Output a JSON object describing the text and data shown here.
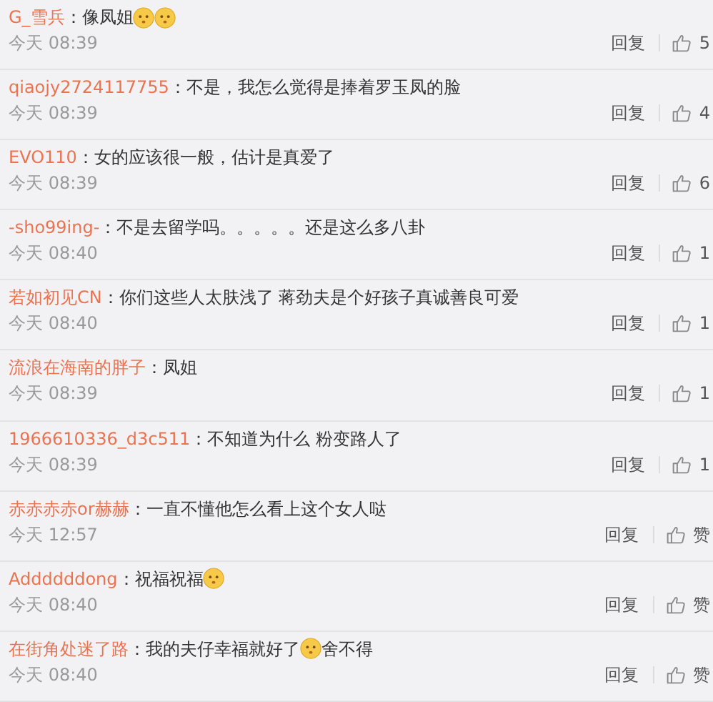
{
  "comments": [
    {
      "user": "G_雪兵",
      "colon": "：",
      "content": [
        {
          "kind": "text",
          "text": "像凤姐"
        },
        {
          "kind": "emoji"
        },
        {
          "kind": "emoji"
        }
      ],
      "time": "今天 08:39",
      "reply": "回复",
      "likes": "5"
    },
    {
      "user": "qiaojy2724117755",
      "colon": "：",
      "content": [
        {
          "kind": "text",
          "text": "不是，我怎么觉得是捧着罗玉凤的脸"
        }
      ],
      "time": "今天 08:39",
      "reply": "回复",
      "likes": "4"
    },
    {
      "user": "EVO110",
      "colon": "：",
      "content": [
        {
          "kind": "text",
          "text": "女的应该很一般，估计是真爱了"
        }
      ],
      "time": "今天 08:39",
      "reply": "回复",
      "likes": "6"
    },
    {
      "user": "-sho99ing-",
      "colon": "：",
      "content": [
        {
          "kind": "text",
          "text": "不是去留学吗。。。。。还是这么多八卦"
        }
      ],
      "time": "今天 08:40",
      "reply": "回复",
      "likes": "1"
    },
    {
      "user": "若如初见CN",
      "colon": "：",
      "content": [
        {
          "kind": "text",
          "text": "你们这些人太肤浅了 蒋劲夫是个好孩子真诚善良可爱"
        }
      ],
      "time": "今天 08:40",
      "reply": "回复",
      "likes": "1"
    },
    {
      "user": "流浪在海南的胖子",
      "colon": "：",
      "content": [
        {
          "kind": "text",
          "text": "凤姐"
        }
      ],
      "time": "今天 08:39",
      "reply": "回复",
      "likes": "1"
    },
    {
      "user": "1966610336_d3c511",
      "colon": "：",
      "content": [
        {
          "kind": "text",
          "text": "不知道为什么 粉变路人了"
        }
      ],
      "time": "今天 08:39",
      "reply": "回复",
      "likes": "1"
    },
    {
      "user": "赤赤赤赤or赫赫",
      "colon": "：",
      "content": [
        {
          "kind": "text",
          "text": "一直不懂他怎么看上这个女人哒"
        }
      ],
      "time": "今天 12:57",
      "reply": "回复",
      "likes": "赞"
    },
    {
      "user": "Addddddong",
      "colon": "：",
      "content": [
        {
          "kind": "text",
          "text": "祝福祝福"
        },
        {
          "kind": "emoji"
        }
      ],
      "time": "今天 08:40",
      "reply": "回复",
      "likes": "赞"
    },
    {
      "user": "在街角处迷了路",
      "colon": "：",
      "content": [
        {
          "kind": "text",
          "text": "我的夫仔幸福就好了"
        },
        {
          "kind": "emoji"
        },
        {
          "kind": "text",
          "text": "舍不得"
        }
      ],
      "time": "今天 08:40",
      "reply": "回复",
      "likes": "赞"
    }
  ]
}
